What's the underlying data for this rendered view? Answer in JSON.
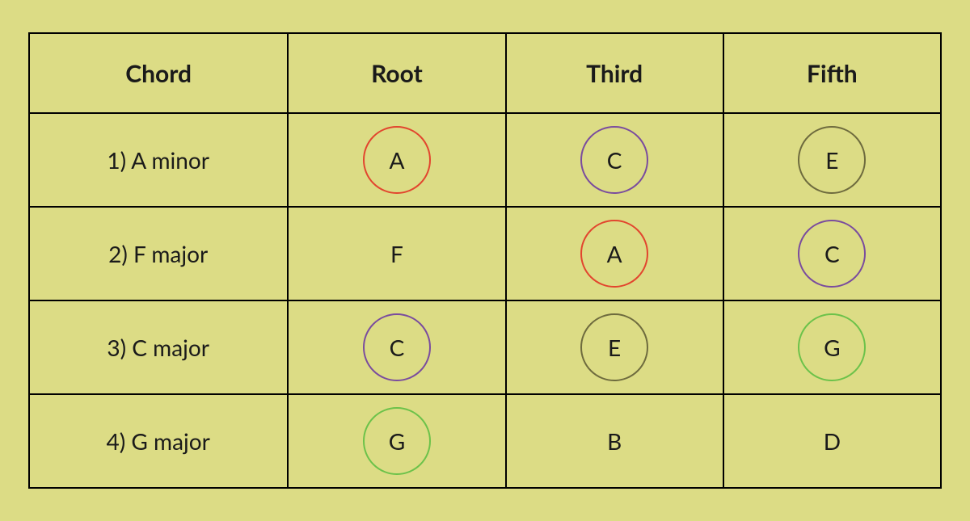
{
  "colors": {
    "red": "#E2452E",
    "purple": "#7A4C9E",
    "olive": "#6E6B3E",
    "green": "#6CC24A",
    "background": "#DCDC85"
  },
  "headers": {
    "chord": "Chord",
    "root": "Root",
    "third": "Third",
    "fifth": "Fifth"
  },
  "rows": [
    {
      "label": "1) A minor",
      "root": {
        "note": "A",
        "circle": "red"
      },
      "third": {
        "note": "C",
        "circle": "purple"
      },
      "fifth": {
        "note": "E",
        "circle": "olive"
      }
    },
    {
      "label": "2) F major",
      "root": {
        "note": "F",
        "circle": null
      },
      "third": {
        "note": "A",
        "circle": "red"
      },
      "fifth": {
        "note": "C",
        "circle": "purple"
      }
    },
    {
      "label": "3) C major",
      "root": {
        "note": "C",
        "circle": "purple"
      },
      "third": {
        "note": "E",
        "circle": "olive"
      },
      "fifth": {
        "note": "G",
        "circle": "green"
      }
    },
    {
      "label": "4) G major",
      "root": {
        "note": "G",
        "circle": "green"
      },
      "third": {
        "note": "B",
        "circle": null
      },
      "fifth": {
        "note": "D",
        "circle": null
      }
    }
  ]
}
